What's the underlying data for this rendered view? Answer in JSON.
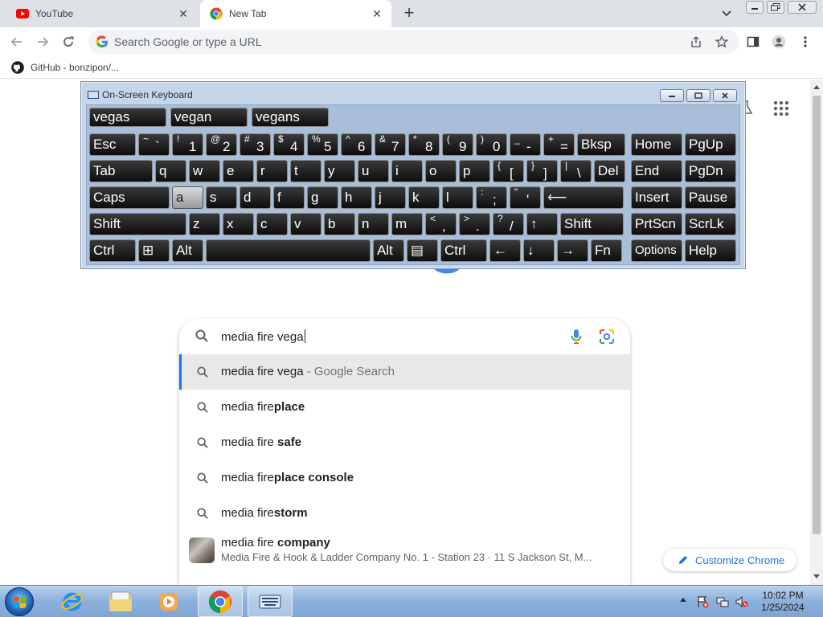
{
  "browser": {
    "tabs": [
      {
        "title": "YouTube",
        "icon": "youtube-icon"
      },
      {
        "title": "New Tab",
        "icon": "chrome-icon",
        "active": true
      }
    ],
    "omnibox_placeholder": "Search Google or type a URL",
    "bookmark": {
      "label": "GitHub - bonzipon/...",
      "icon": "github-icon"
    }
  },
  "search": {
    "query": "media fire vega",
    "suggestions": [
      {
        "prefix": "media fire vega",
        "suffix": " - Google Search",
        "selected": true
      },
      {
        "prefix": "media fire",
        "bold": "place"
      },
      {
        "prefix": "media fire ",
        "bold": "safe"
      },
      {
        "prefix": "media fire",
        "bold": "place console"
      },
      {
        "prefix": "media fire",
        "bold": "storm"
      }
    ],
    "entity": {
      "prefix": "media fire ",
      "bold": "company",
      "subtitle": "Media Fire & Hook & Ladder Company No. 1 - Station 23 · 11 S Jackson St, M..."
    }
  },
  "customize_label": "Customize Chrome",
  "osk": {
    "title": "On-Screen Keyboard",
    "predictions": [
      "vegas",
      "vegan",
      "vegans"
    ],
    "rows": [
      [
        {
          "l": "Esc"
        },
        {
          "s": "~",
          "m": "`"
        },
        {
          "s": "!",
          "m": "1"
        },
        {
          "s": "@",
          "m": "2"
        },
        {
          "s": "#",
          "m": "3"
        },
        {
          "s": "$",
          "m": "4"
        },
        {
          "s": "%",
          "m": "5"
        },
        {
          "s": "^",
          "m": "6"
        },
        {
          "s": "&",
          "m": "7"
        },
        {
          "s": "*",
          "m": "8"
        },
        {
          "s": "(",
          "m": "9"
        },
        {
          "s": ")",
          "m": "0"
        },
        {
          "s": "_",
          "m": "-"
        },
        {
          "s": "+",
          "m": "="
        },
        {
          "l": "Bksp"
        },
        {
          "l": "Home"
        },
        {
          "l": "PgUp"
        }
      ],
      [
        {
          "l": "Tab"
        },
        {
          "l": "q"
        },
        {
          "l": "w"
        },
        {
          "l": "e"
        },
        {
          "l": "r"
        },
        {
          "l": "t"
        },
        {
          "l": "y"
        },
        {
          "l": "u"
        },
        {
          "l": "i"
        },
        {
          "l": "o"
        },
        {
          "l": "p"
        },
        {
          "s": "{",
          "m": "["
        },
        {
          "s": "}",
          "m": "]"
        },
        {
          "s": "|",
          "m": "\\"
        },
        {
          "l": "Del"
        },
        {
          "l": "End"
        },
        {
          "l": "PgDn"
        }
      ],
      [
        {
          "l": "Caps"
        },
        {
          "l": "a",
          "pressed": true
        },
        {
          "l": "s"
        },
        {
          "l": "d"
        },
        {
          "l": "f"
        },
        {
          "l": "g"
        },
        {
          "l": "h"
        },
        {
          "l": "j"
        },
        {
          "l": "k"
        },
        {
          "l": "l"
        },
        {
          "s": ":",
          "m": ";"
        },
        {
          "s": "\"",
          "m": "'"
        },
        {
          "l": "⟵"
        },
        {
          "l": "Insert"
        },
        {
          "l": "Pause"
        }
      ],
      [
        {
          "l": "Shift"
        },
        {
          "l": "z"
        },
        {
          "l": "x"
        },
        {
          "l": "c"
        },
        {
          "l": "v"
        },
        {
          "l": "b"
        },
        {
          "l": "n"
        },
        {
          "l": "m"
        },
        {
          "s": "<",
          "m": ","
        },
        {
          "s": ">",
          "m": "."
        },
        {
          "s": "?",
          "m": "/"
        },
        {
          "l": "↑"
        },
        {
          "l": "Shift"
        },
        {
          "l": "PrtScn"
        },
        {
          "l": "ScrLk"
        }
      ],
      [
        {
          "l": "Ctrl"
        },
        {
          "l": "⊞",
          "icon": "windows-key-icon"
        },
        {
          "l": "Alt"
        },
        {
          "l": "",
          "name": "space"
        },
        {
          "l": "Alt"
        },
        {
          "l": "▤",
          "icon": "menu-key-icon"
        },
        {
          "l": "Ctrl"
        },
        {
          "l": "←"
        },
        {
          "l": "↓"
        },
        {
          "l": "→"
        },
        {
          "l": "Fn"
        },
        {
          "l": "Options",
          "small": true
        },
        {
          "l": "Help"
        }
      ]
    ]
  },
  "taskbar": {
    "apps": [
      "internet-explorer-icon",
      "file-explorer-icon",
      "media-player-icon",
      "chrome-icon",
      "on-screen-keyboard-icon"
    ],
    "time": "10:02 PM",
    "date": "1/25/2024"
  },
  "colors": {
    "accent": "#1a73e8",
    "google_blue": "#4285f4",
    "youtube_red": "#ff0000",
    "osk_frame": "#c5d6ea"
  }
}
